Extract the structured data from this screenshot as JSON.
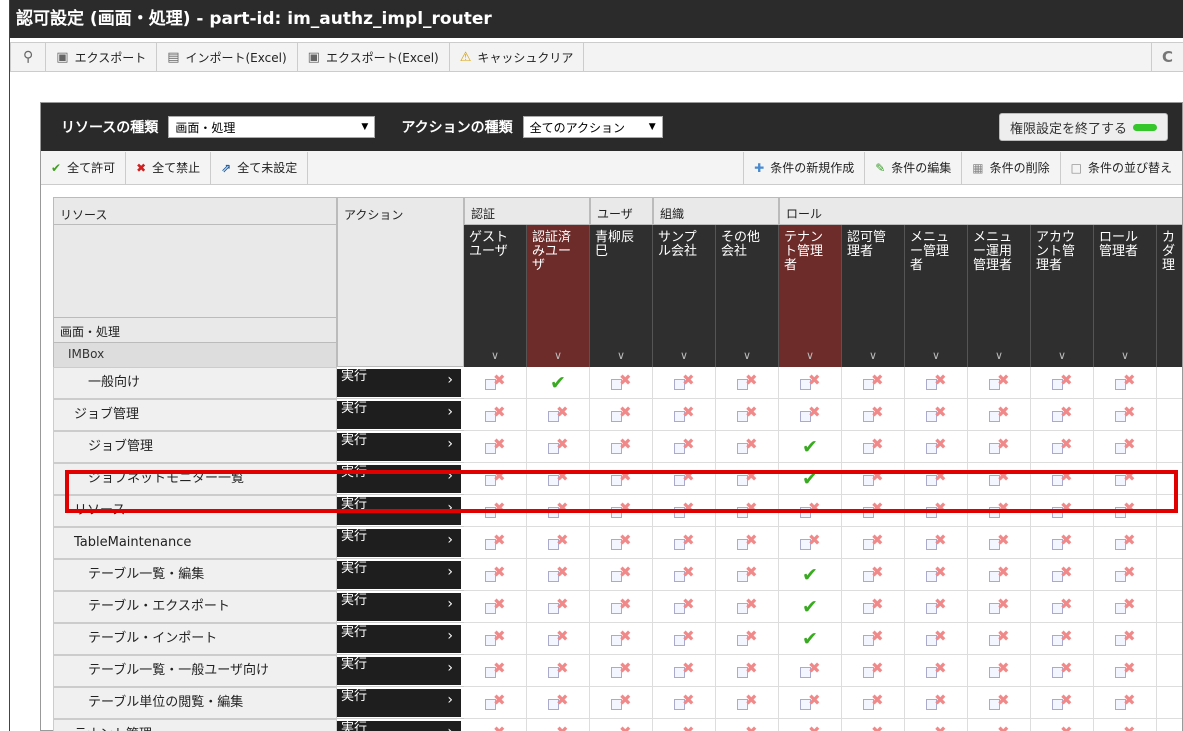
{
  "window": {
    "title": "認可設定 (画面・処理) - part-id: im_authz_impl_router"
  },
  "toolbar": {
    "export_label": "エクスポート",
    "import_excel_label": "インポート(Excel)",
    "export_excel_label": "エクスポート(Excel)",
    "cache_clear_label": "キャッシュクリア",
    "refresh_glyph": "C"
  },
  "filter": {
    "resource_type_label": "リソースの種類",
    "resource_type_value": "画面・処理",
    "action_type_label": "アクションの種類",
    "action_type_value": "全てのアクション",
    "end_button_label": "権限設定を終了する"
  },
  "actions": {
    "allow_all": "全て許可",
    "deny_all": "全て禁止",
    "unset_all": "全て未設定",
    "new_condition": "条件の新規作成",
    "edit_condition": "条件の編集",
    "delete_condition": "条件の削除",
    "sort_condition": "条件の並び替え"
  },
  "grid": {
    "resource_header": "リソース",
    "action_header": "アクション",
    "screen_label": "画面・処理",
    "imbox_label": "IMBox",
    "groups": [
      {
        "label": "認証"
      },
      {
        "label": "ユーザ"
      },
      {
        "label": "組織"
      },
      {
        "label": "ロール"
      }
    ],
    "columns": [
      {
        "label": "ゲスト\nユーザ",
        "highlighted": false
      },
      {
        "label": "認証済\nみユー\nザ",
        "highlighted": true
      },
      {
        "label": "青柳辰\n巳",
        "highlighted": false
      },
      {
        "label": "サンプ\nル会社",
        "highlighted": false
      },
      {
        "label": "その他\n会社",
        "highlighted": false
      },
      {
        "label": "テナン\nト管理\n者",
        "highlighted": true
      },
      {
        "label": "認可管\n理者",
        "highlighted": false
      },
      {
        "label": "メニュ\nー管理\n者",
        "highlighted": false
      },
      {
        "label": "メニュ\nー運用\n管理者",
        "highlighted": false
      },
      {
        "label": "アカウ\nント管\n理者",
        "highlighted": false
      },
      {
        "label": "ロール\n管理者",
        "highlighted": false
      },
      {
        "label": "カ\nダ\n理",
        "highlighted": false
      }
    ],
    "action_value": "実行",
    "rows": [
      {
        "label": "一般向け",
        "indent": 2,
        "cells": [
          "x",
          "ok",
          "x",
          "x",
          "x",
          "x",
          "x",
          "x",
          "x",
          "x",
          "x",
          "f"
        ]
      },
      {
        "label": "ジョブ管理",
        "indent": 1,
        "cells": [
          "x",
          "x",
          "x",
          "x",
          "x",
          "x",
          "x",
          "x",
          "x",
          "x",
          "x",
          "f"
        ]
      },
      {
        "label": "ジョブ管理",
        "indent": 2,
        "cells": [
          "x",
          "x",
          "x",
          "x",
          "x",
          "ok",
          "x",
          "x",
          "x",
          "x",
          "x",
          "f"
        ]
      },
      {
        "label": "ジョブネットモニター一覧",
        "indent": 2,
        "cells": [
          "x",
          "x",
          "x",
          "x",
          "x",
          "ok",
          "x",
          "x",
          "x",
          "x",
          "x",
          "f"
        ]
      },
      {
        "label": "リソース",
        "indent": 1,
        "cells": [
          "x",
          "x",
          "x",
          "x",
          "x",
          "x",
          "x",
          "x",
          "x",
          "x",
          "x",
          "f"
        ]
      },
      {
        "label": "TableMaintenance",
        "indent": 1,
        "cells": [
          "x",
          "x",
          "x",
          "x",
          "x",
          "x",
          "x",
          "x",
          "x",
          "x",
          "x",
          "f"
        ]
      },
      {
        "label": "テーブル一覧・編集",
        "indent": 2,
        "cells": [
          "x",
          "x",
          "x",
          "x",
          "x",
          "ok",
          "x",
          "x",
          "x",
          "x",
          "x",
          "f"
        ]
      },
      {
        "label": "テーブル・エクスポート",
        "indent": 2,
        "cells": [
          "x",
          "x",
          "x",
          "x",
          "x",
          "ok",
          "x",
          "x",
          "x",
          "x",
          "x",
          "f"
        ]
      },
      {
        "label": "テーブル・インポート",
        "indent": 2,
        "cells": [
          "x",
          "x",
          "x",
          "x",
          "x",
          "ok",
          "x",
          "x",
          "x",
          "x",
          "x",
          "f"
        ]
      },
      {
        "label": "テーブル一覧・一般ユーザ向け",
        "indent": 2,
        "cells": [
          "x",
          "x",
          "x",
          "x",
          "x",
          "x",
          "x",
          "x",
          "x",
          "x",
          "x",
          "f"
        ]
      },
      {
        "label": "テーブル単位の閲覧・編集",
        "indent": 2,
        "cells": [
          "x",
          "x",
          "x",
          "x",
          "x",
          "x",
          "x",
          "x",
          "x",
          "x",
          "x",
          "f"
        ]
      },
      {
        "label": "テナント管理",
        "indent": 1,
        "cells": [
          "x",
          "x",
          "x",
          "x",
          "x",
          "x",
          "x",
          "x",
          "x",
          "x",
          "x",
          "f"
        ]
      }
    ]
  },
  "colors": {
    "highlight_outline": "#e00000",
    "header_dark": "#2f2f2f",
    "header_red": "#6d2b29",
    "allow_green": "#3aaa22"
  }
}
